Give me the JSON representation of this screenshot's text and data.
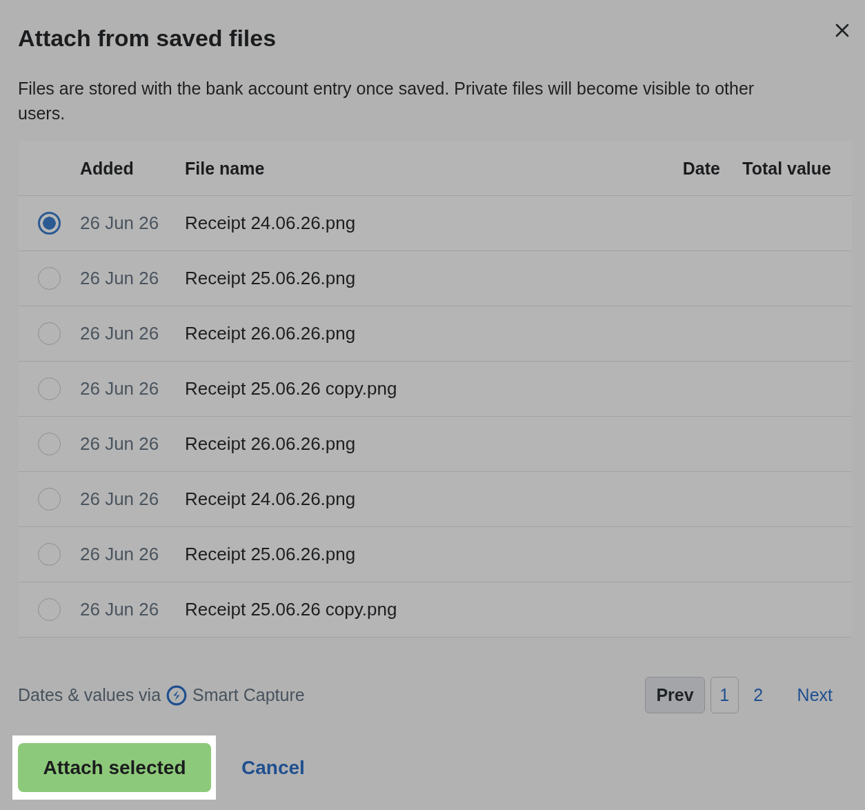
{
  "dialog": {
    "title": "Attach from saved files",
    "description": "Files are stored with the bank account entry once saved. Private files will become visible to other users."
  },
  "table": {
    "columns": [
      "Added",
      "File name",
      "Date",
      "Total value"
    ],
    "rows": [
      {
        "selected": true,
        "added": "26 Jun 26",
        "file_name": "Receipt 24.06.26.png"
      },
      {
        "selected": false,
        "added": "26 Jun 26",
        "file_name": "Receipt 25.06.26.png"
      },
      {
        "selected": false,
        "added": "26 Jun 26",
        "file_name": "Receipt 26.06.26.png"
      },
      {
        "selected": false,
        "added": "26 Jun 26",
        "file_name": "Receipt 25.06.26 copy.png"
      },
      {
        "selected": false,
        "added": "26 Jun 26",
        "file_name": "Receipt 26.06.26.png"
      },
      {
        "selected": false,
        "added": "26 Jun 26",
        "file_name": "Receipt 24.06.26.png"
      },
      {
        "selected": false,
        "added": "26 Jun 26",
        "file_name": "Receipt 25.06.26.png"
      },
      {
        "selected": false,
        "added": "26 Jun 26",
        "file_name": "Receipt 25.06.26 copy.png"
      }
    ]
  },
  "footer": {
    "note": "Dates & values via",
    "brand": "Smart Capture"
  },
  "pagination": {
    "prev": {
      "label": "Prev",
      "disabled": true
    },
    "pages": [
      {
        "label": "1",
        "selected": true
      },
      {
        "label": "2",
        "selected": false
      }
    ],
    "next": {
      "label": "Next",
      "disabled": false
    }
  },
  "actions": {
    "primary": {
      "label": "Attach selected",
      "focused": true
    },
    "secondary": {
      "label": "Cancel"
    }
  }
}
